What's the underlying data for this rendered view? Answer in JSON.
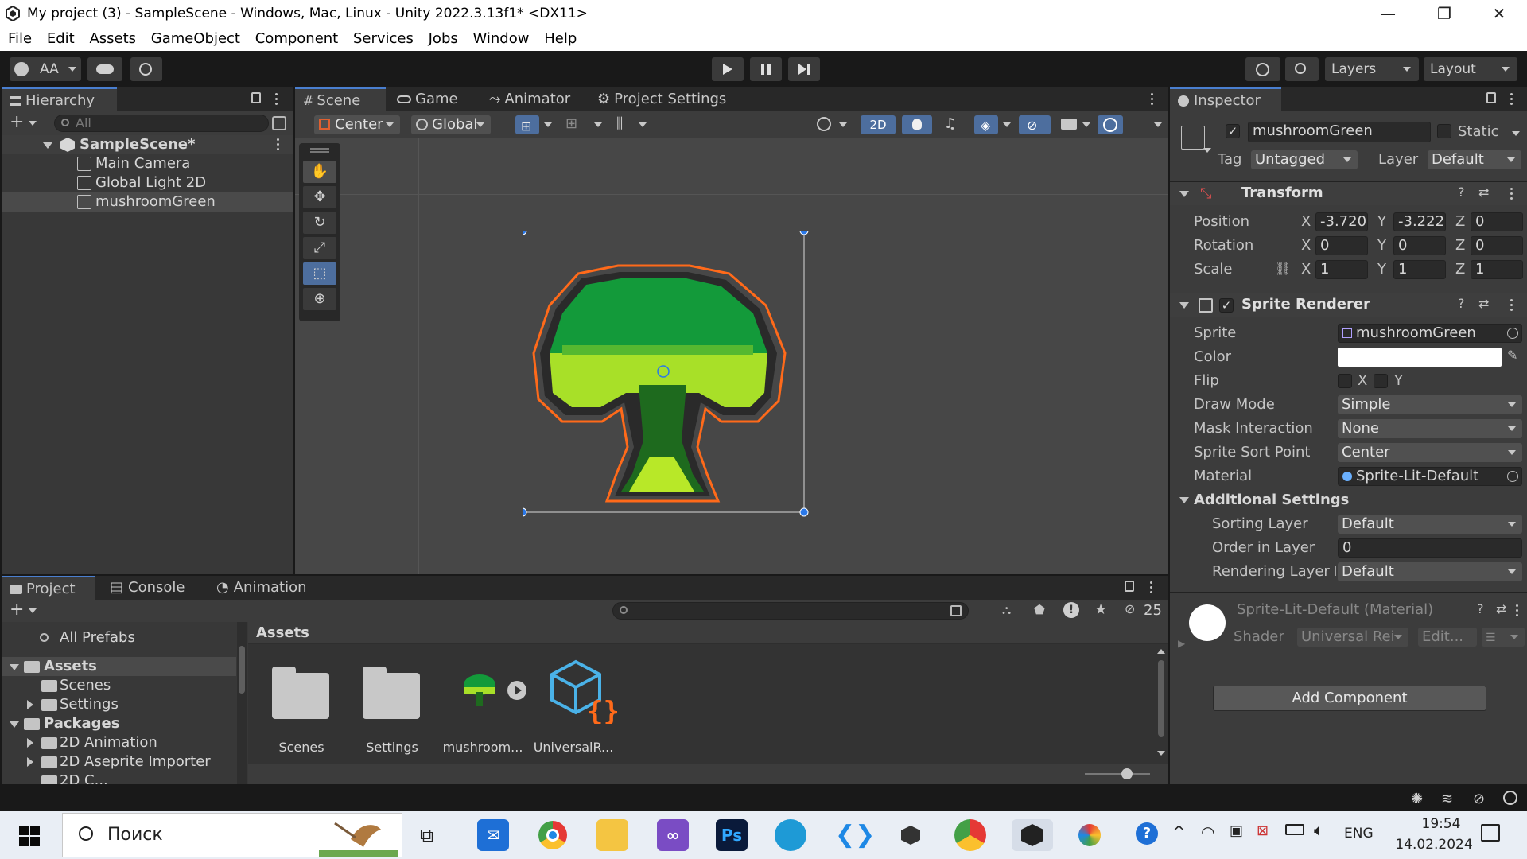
{
  "window": {
    "title": "My project (3) - SampleScene - Windows, Mac, Linux - Unity 2022.3.13f1* <DX11>",
    "controls": [
      "—",
      "❐",
      "✕"
    ]
  },
  "menu": [
    "File",
    "Edit",
    "Assets",
    "GameObject",
    "Component",
    "Services",
    "Jobs",
    "Window",
    "Help"
  ],
  "toolbar": {
    "account": "AA",
    "layers": "Layers",
    "layout": "Layout"
  },
  "hierarchy": {
    "tab": "Hierarchy",
    "search_placeholder": "All",
    "scene": "SampleScene*",
    "items": [
      "Main Camera",
      "Global Light 2D",
      "mushroomGreen"
    ]
  },
  "scene_tabs": [
    "Scene",
    "Game",
    "Animator",
    "Project Settings"
  ],
  "scene_toolbar": {
    "pivot": "Center",
    "space": "Global",
    "mode_2d": "2D"
  },
  "inspector": {
    "tab": "Inspector",
    "object_name": "mushroomGreen",
    "static_label": "Static",
    "tag_label": "Tag",
    "tag_value": "Untagged",
    "layer_label": "Layer",
    "layer_value": "Default",
    "transform": {
      "title": "Transform",
      "position_label": "Position",
      "rotation_label": "Rotation",
      "scale_label": "Scale",
      "position": {
        "x": "-3.720",
        "y": "-3.222",
        "z": "0"
      },
      "rotation": {
        "x": "0",
        "y": "0",
        "z": "0"
      },
      "scale": {
        "x": "1",
        "y": "1",
        "z": "1"
      }
    },
    "sprite_renderer": {
      "title": "Sprite Renderer",
      "sprite_label": "Sprite",
      "sprite_value": "mushroomGreen",
      "color_label": "Color",
      "color_value": "#ffffff",
      "flip_label": "Flip",
      "flip_x": "X",
      "flip_y": "Y",
      "draw_mode_label": "Draw Mode",
      "draw_mode_value": "Simple",
      "mask_label": "Mask Interaction",
      "mask_value": "None",
      "sort_point_label": "Sprite Sort Point",
      "sort_point_value": "Center",
      "material_label": "Material",
      "material_value": "Sprite-Lit-Default",
      "additional_title": "Additional Settings",
      "sorting_layer_label": "Sorting Layer",
      "sorting_layer_value": "Default",
      "order_label": "Order in Layer",
      "order_value": "0",
      "rendering_layer_label": "Rendering Layer M",
      "rendering_layer_value": "Default"
    },
    "material": {
      "title": "Sprite-Lit-Default (Material)",
      "shader_label": "Shader",
      "shader_value": "Universal Rei",
      "edit_label": "Edit..."
    },
    "add_component": "Add Component"
  },
  "project": {
    "tabs": [
      "Project",
      "Console",
      "Animation"
    ],
    "hidden_count": "25",
    "breadcrumb": "Assets",
    "tree": [
      {
        "label": "All Prefabs",
        "kind": "search"
      },
      {
        "label": "Assets",
        "kind": "root"
      },
      {
        "label": "Scenes",
        "kind": "child"
      },
      {
        "label": "Settings",
        "kind": "child"
      },
      {
        "label": "Packages",
        "kind": "root"
      },
      {
        "label": "2D Animation",
        "kind": "child"
      },
      {
        "label": "2D Aseprite Importer",
        "kind": "child"
      },
      {
        "label": "2D C...",
        "kind": "child"
      }
    ],
    "assets": [
      "Scenes",
      "Settings",
      "mushroom...",
      "UniversalR..."
    ]
  },
  "taskbar": {
    "search_text": "Поиск",
    "lang": "ENG",
    "time": "19:54",
    "date": "14.02.2024"
  },
  "colors": {
    "accent": "#4a7fd0",
    "selection_outline": "#ff6a1a",
    "handle": "#2a78e8"
  }
}
